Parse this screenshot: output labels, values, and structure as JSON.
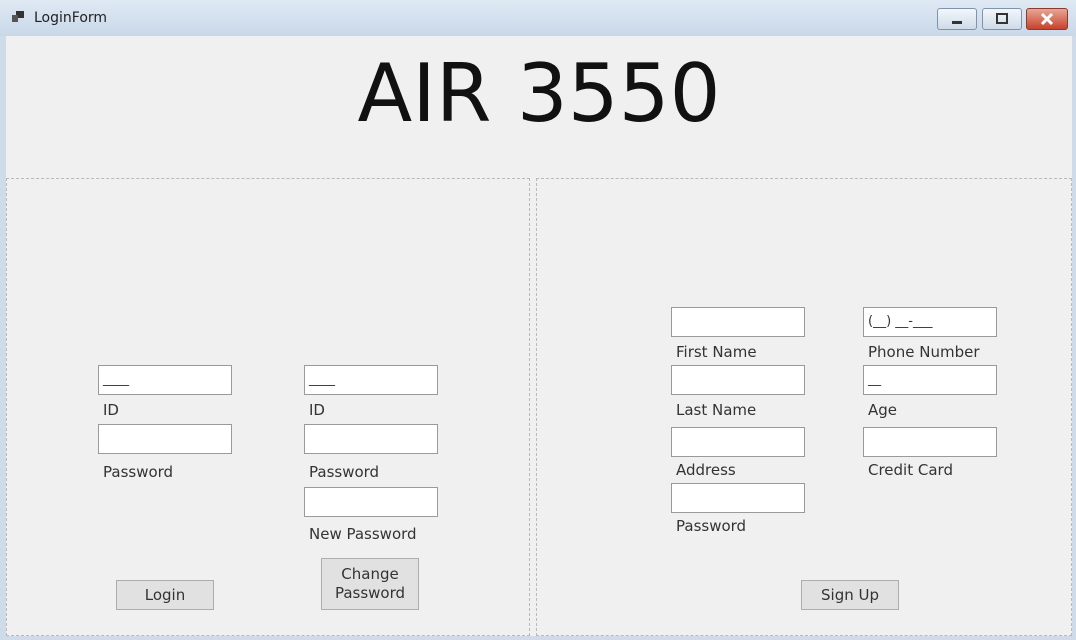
{
  "window": {
    "title": "LoginForm"
  },
  "header": {
    "title": "AIR 3550"
  },
  "login_panel": {
    "id_value": "____",
    "id_label": "ID",
    "password_label": "Password",
    "login_button": "Login"
  },
  "change_panel": {
    "id_value": "____",
    "id_label": "ID",
    "password_label": "Password",
    "new_password_label": "New Password",
    "change_button_line1": "Change",
    "change_button_line2": "Password"
  },
  "signup_panel": {
    "first_name_label": "First Name",
    "last_name_label": "Last Name",
    "address_label": "Address",
    "password_label": "Password",
    "phone_value": "(__) __-___",
    "phone_label": "Phone Number",
    "age_value": "__",
    "age_label": "Age",
    "credit_card_label": "Credit Card",
    "signup_button": "Sign Up"
  }
}
